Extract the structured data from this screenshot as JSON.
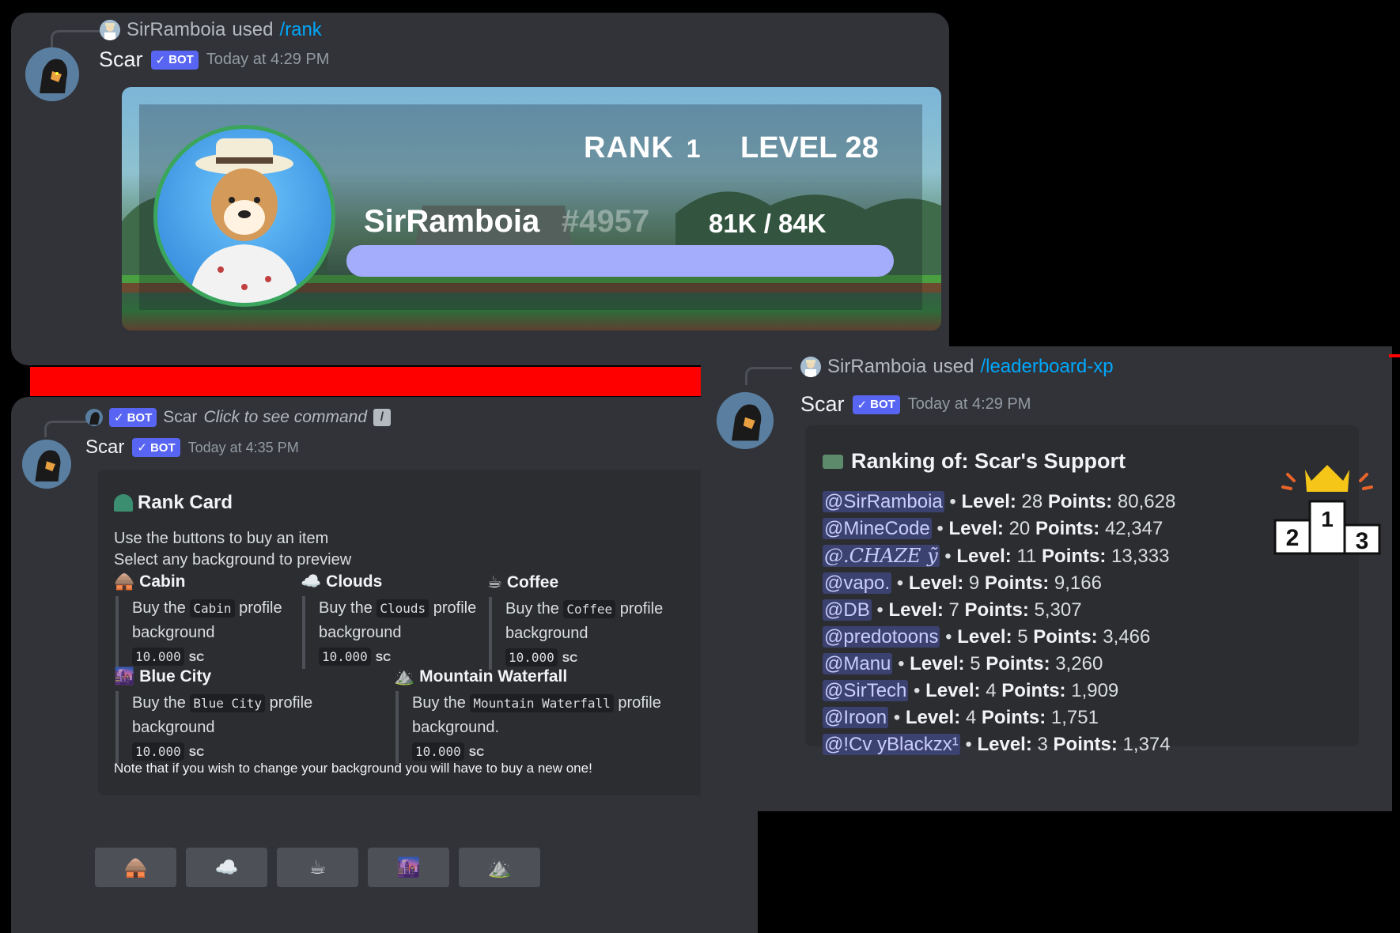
{
  "panel_rank": {
    "reply_user": "SirRamboia",
    "reply_used": "used",
    "reply_command": "/rank",
    "bot_name": "Scar",
    "bot_badge": "BOT",
    "timestamp": "Today at 4:29 PM",
    "card": {
      "rank_label": "RANK",
      "rank_value": "1",
      "level_label": "LEVEL",
      "level_value": "28",
      "username": "SirRamboia",
      "discriminator": "#4957",
      "xp_text": "81K  / 84K",
      "progress": 0.964
    }
  },
  "panel_shop": {
    "reply_badge": "BOT",
    "reply_name": "Scar",
    "reply_hint": "Click to see command",
    "bot_name": "Scar",
    "bot_badge": "BOT",
    "timestamp": "Today at 4:35 PM",
    "embed": {
      "title": "Rank Card",
      "description_1": "Use the buttons to buy an item",
      "description_2": "Select any background to preview",
      "fields": [
        {
          "name": "Cabin",
          "buy": "Buy the",
          "code": "Cabin",
          "rest": "profile",
          "line2": "background",
          "price": "10.000",
          "currency": "SC"
        },
        {
          "name": "Clouds",
          "buy": "Buy the",
          "code": "Clouds",
          "rest": "profile",
          "line2": "background",
          "price": "10.000",
          "currency": "SC"
        },
        {
          "name": "Coffee",
          "buy": "Buy the",
          "code": "Coffee",
          "rest": "profile",
          "line2": "background",
          "price": "10.000",
          "currency": "SC"
        },
        {
          "name": "Blue City",
          "buy": "Buy the",
          "code": "Blue City",
          "rest": "profile",
          "line2": "background",
          "price": "10.000",
          "currency": "SC"
        },
        {
          "name": "Mountain Waterfall",
          "buy": "Buy the",
          "code": "Mountain Waterfall",
          "rest": "profile",
          "line2": "background.",
          "price": "10.000",
          "currency": "SC"
        }
      ],
      "note": "Note that if you wish to change your background you will have to buy a new one!"
    },
    "buttons": [
      "cabin-icon",
      "cloud-icon",
      "coffee-icon",
      "city-icon",
      "mountain-icon"
    ]
  },
  "panel_leaderboard": {
    "reply_user": "SirRamboia",
    "reply_used": "used",
    "reply_command": "/leaderboard-xp",
    "bot_name": "Scar",
    "bot_badge": "BOT",
    "timestamp": "Today at 4:29 PM",
    "embed": {
      "title": "Ranking of: Scar's Support",
      "level_label": "Level:",
      "points_label": "Points:",
      "rows": [
        {
          "user": "@SirRamboia",
          "level": "28",
          "points": "80,628"
        },
        {
          "user": "@MineCode",
          "level": "20",
          "points": "42,347"
        },
        {
          "user": "@.CHAZE ỹ",
          "level": "11",
          "points": "13,333"
        },
        {
          "user": "@vapo.",
          "level": "9",
          "points": "9,166"
        },
        {
          "user": "@DB",
          "level": "7",
          "points": "5,307"
        },
        {
          "user": "@predotoons",
          "level": "5",
          "points": "3,466"
        },
        {
          "user": "@Manu",
          "level": "5",
          "points": "3,260"
        },
        {
          "user": "@SirTech",
          "level": "4",
          "points": "1,909"
        },
        {
          "user": "@Iroon",
          "level": "4",
          "points": "1,751"
        },
        {
          "user": "@!Cv yBlackzx¹",
          "level": "3",
          "points": "1,374"
        }
      ],
      "podium": {
        "first": "1",
        "second": "2",
        "third": "3"
      }
    }
  }
}
